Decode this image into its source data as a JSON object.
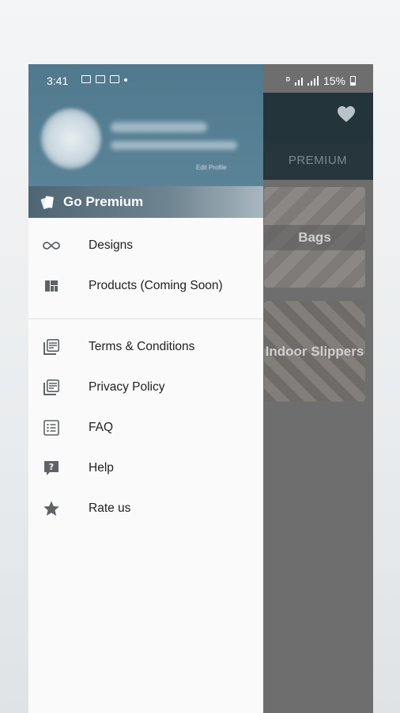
{
  "status_bar": {
    "time": "3:41",
    "battery": "15%"
  },
  "background_app": {
    "premium_tab": "PREMIUM",
    "cards": [
      {
        "label": "Bags"
      },
      {
        "label": "Indoor Slippers"
      }
    ]
  },
  "drawer": {
    "header": {
      "edit_profile": "Edit Profile"
    },
    "go_premium": "Go Premium",
    "menu_primary": [
      {
        "label": "Designs",
        "icon": "infinity-icon"
      },
      {
        "label": "Products (Coming Soon)",
        "icon": "dashboard-icon"
      }
    ],
    "menu_secondary": [
      {
        "label": "Terms & Conditions",
        "icon": "library-books-icon"
      },
      {
        "label": "Privacy Policy",
        "icon": "library-books-icon"
      },
      {
        "label": "FAQ",
        "icon": "list-icon"
      },
      {
        "label": "Help",
        "icon": "help-icon"
      },
      {
        "label": "Rate us",
        "icon": "star-icon"
      }
    ]
  },
  "colors": {
    "header": "#5a8398",
    "scrim": "#6e6e6e",
    "topbar": "#24343b",
    "icon": "#5f6368"
  }
}
